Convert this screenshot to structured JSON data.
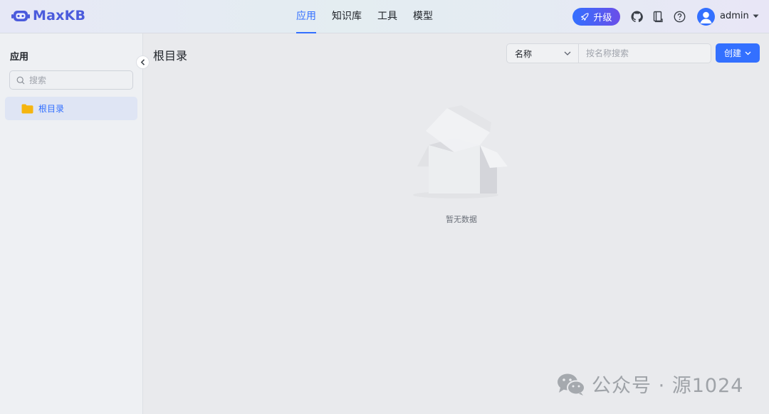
{
  "app": {
    "name": "MaxKB"
  },
  "nav": {
    "items": [
      "应用",
      "知识库",
      "工具",
      "模型"
    ],
    "active_index": 0
  },
  "header": {
    "upgrade_label": "升级",
    "username": "admin"
  },
  "sidebar": {
    "title": "应用",
    "search_placeholder": "搜索",
    "tree": [
      {
        "label": "根目录",
        "icon": "folder-icon"
      }
    ]
  },
  "main": {
    "title": "根目录",
    "filter": {
      "field_label": "名称",
      "search_placeholder": "按名称搜索"
    },
    "create_label": "创建",
    "empty_text": "暂无数据"
  },
  "watermark": {
    "text": "公众号 · 源1024"
  },
  "colors": {
    "accent": "#3370ff",
    "folder": "#f5b50f",
    "brand": "#4b5bdc"
  }
}
